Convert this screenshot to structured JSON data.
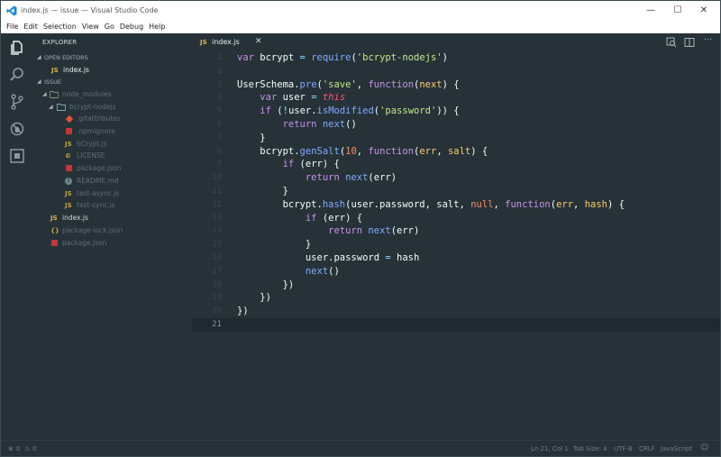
{
  "window": {
    "title": "index.js — issue — Visual Studio Code",
    "minimize": "—",
    "maximize": "☐",
    "close": "✕"
  },
  "menu": [
    "File",
    "Edit",
    "Selection",
    "View",
    "Go",
    "Debug",
    "Help"
  ],
  "activity_icons": [
    "files-icon",
    "search-icon",
    "source-control-icon",
    "debug-icon",
    "extensions-icon"
  ],
  "sidebar": {
    "title": "EXPLORER",
    "open_editors_header": "OPEN EDITORS",
    "open_editors": [
      {
        "icon": "JS",
        "name": "index.js"
      }
    ],
    "folder_header": "ISSUE",
    "tree": [
      {
        "type": "folder",
        "name": "node_modules",
        "expanded": true
      },
      {
        "type": "folder",
        "name": "bcrypt-nodejs",
        "expanded": true
      },
      {
        "icon": "git",
        "name": ".gitattributes"
      },
      {
        "icon": "npm",
        "name": ".npmignore"
      },
      {
        "icon": "JS",
        "name": "bCrypt.js"
      },
      {
        "icon": "©",
        "name": "LICENSE"
      },
      {
        "icon": "npm",
        "name": "package.json"
      },
      {
        "icon": "i",
        "name": "README.md"
      },
      {
        "icon": "JS",
        "name": "test-async.js"
      },
      {
        "icon": "JS",
        "name": "test-sync.js"
      },
      {
        "icon": "JS",
        "name": "index.js"
      },
      {
        "icon": "{}",
        "name": "package-lock.json"
      },
      {
        "icon": "npm",
        "name": "package.json"
      }
    ]
  },
  "tab": {
    "icon": "JS",
    "name": "index.js",
    "close": "✕"
  },
  "code_lines": [
    "1",
    "2",
    "3",
    "4",
    "5",
    "6",
    "7",
    "8",
    "9",
    "10",
    "11",
    "12",
    "13",
    "14",
    "15",
    "16",
    "17",
    "18",
    "19",
    "20",
    "21"
  ],
  "current_line": 21,
  "status": {
    "errors": "0",
    "warnings": "0",
    "position": "Ln 21, Col 1",
    "tab_size": "Tab Size: 4",
    "encoding": "UTF-8",
    "eol": "CRLF",
    "language": "JavaScript"
  },
  "colors": {
    "background": "#263238",
    "keyword": "#c792ea",
    "function": "#82aaff",
    "string": "#c3e88d",
    "number": "#f78c6c",
    "parameter": "#ffcb6b",
    "this": "#ff5370",
    "text": "#eeffff"
  }
}
